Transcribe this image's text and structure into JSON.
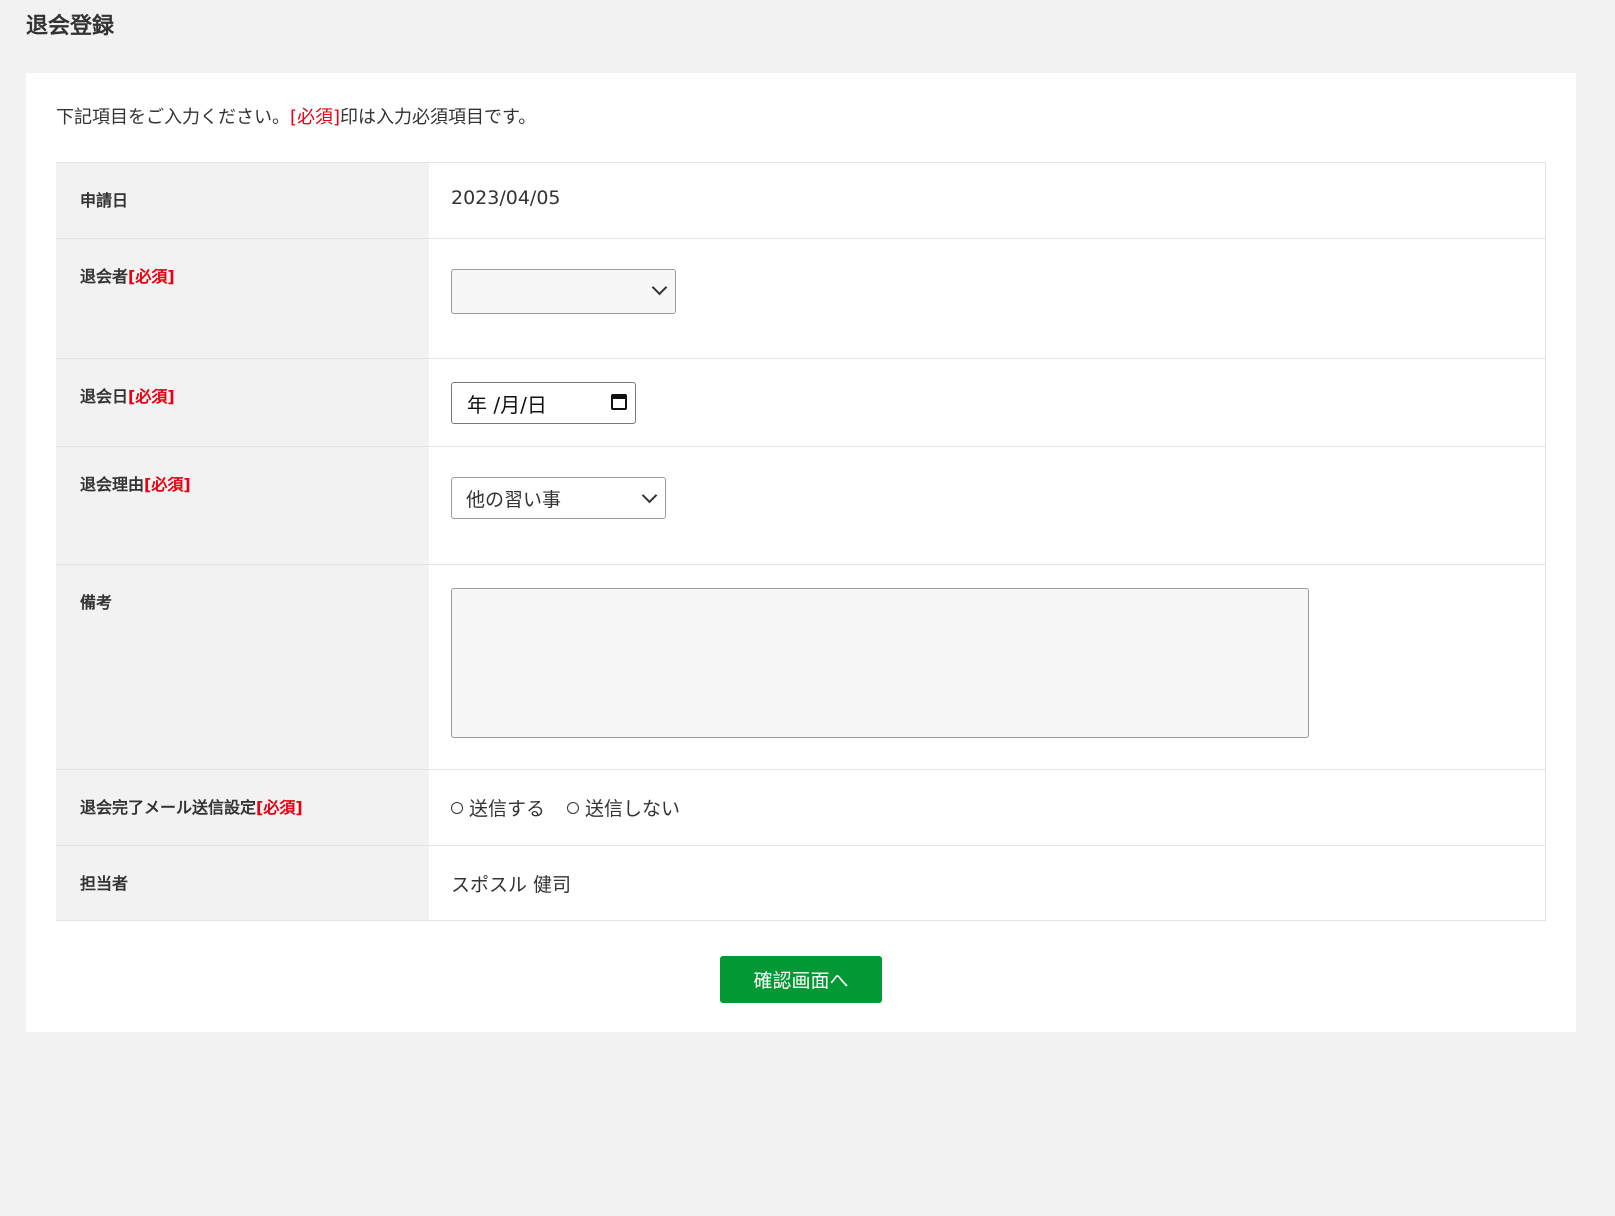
{
  "page": {
    "title": "退会登録"
  },
  "intro": {
    "before": "下記項目をご入力ください。",
    "required_marker": "[必須]",
    "after": "印は入力必須項目です。"
  },
  "form": {
    "required_marker": "[必須]",
    "application_date": {
      "label": "申請日",
      "value": "2023/04/05"
    },
    "member": {
      "label": "退会者",
      "value": ""
    },
    "withdraw_date": {
      "label": "退会日",
      "placeholder": "年 /月/日"
    },
    "reason": {
      "label": "退会理由",
      "value": "他の習い事"
    },
    "note": {
      "label": "備考",
      "value": ""
    },
    "mail_setting": {
      "label": "退会完了メール送信設定",
      "options": [
        "送信する",
        "送信しない"
      ]
    },
    "staff": {
      "label": "担当者",
      "value": "スポスル 健司"
    }
  },
  "submit_label": "確認画面へ",
  "colors": {
    "required": "#e60012",
    "submit_bg": "#009933",
    "background": "#f2f2f2"
  }
}
